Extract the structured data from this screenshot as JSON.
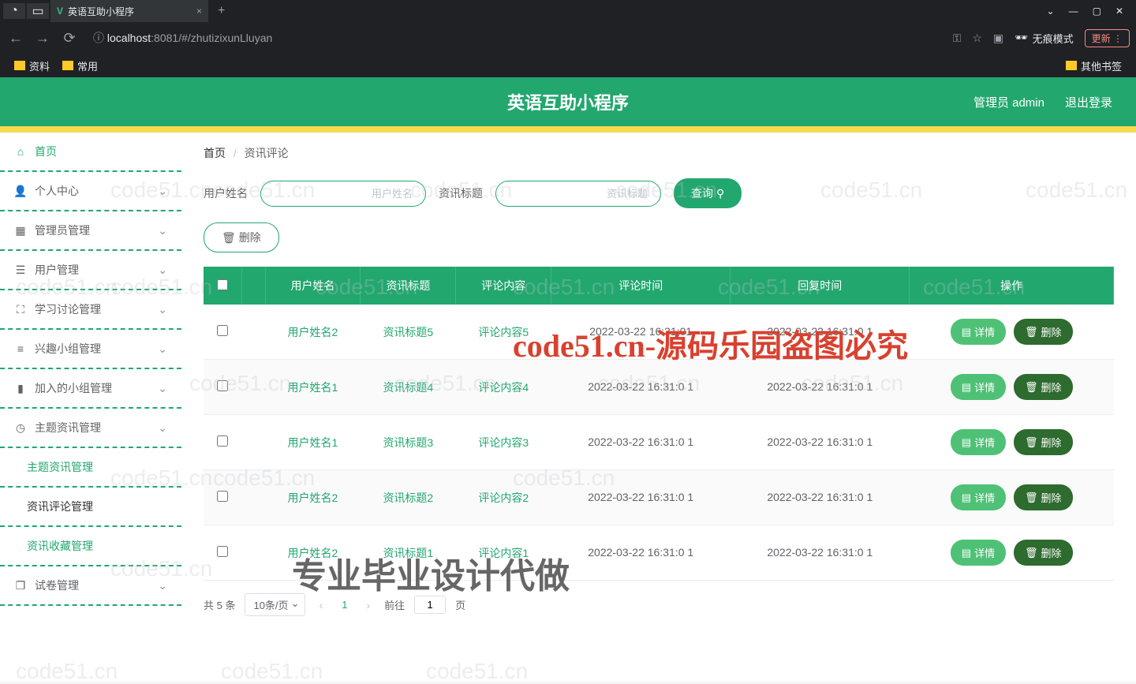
{
  "browser": {
    "tab_title": "英语互助小程序",
    "url_host": "localhost",
    "url_port": ":8081",
    "url_path": "/#/zhutizixunLluyan",
    "bookmarks": [
      "资料",
      "常用"
    ],
    "other_bookmarks": "其他书签",
    "incognito": "无痕模式",
    "update": "更新"
  },
  "header": {
    "title": "英语互助小程序",
    "user_label": "管理员 admin",
    "logout": "退出登录"
  },
  "sidebar": {
    "items": [
      {
        "icon": "home",
        "label": "首页",
        "active": true
      },
      {
        "icon": "user",
        "label": "个人中心",
        "expand": true
      },
      {
        "icon": "admin",
        "label": "管理员管理",
        "expand": true
      },
      {
        "icon": "users",
        "label": "用户管理",
        "expand": true
      },
      {
        "icon": "discuss",
        "label": "学习讨论管理",
        "expand": true
      },
      {
        "icon": "group",
        "label": "兴趣小组管理",
        "expand": true
      },
      {
        "icon": "join",
        "label": "加入的小组管理",
        "expand": true
      },
      {
        "icon": "topic",
        "label": "主题资讯管理",
        "expand": true
      },
      {
        "icon": "paper",
        "label": "试卷管理",
        "expand": true
      }
    ],
    "submenu": [
      "主题资讯管理",
      "资讯评论管理",
      "资讯收藏管理"
    ],
    "submenu_selected_index": 1
  },
  "breadcrumb": {
    "home": "首页",
    "current": "资讯评论"
  },
  "search": {
    "label1": "用户姓名",
    "ph1": "用户姓名",
    "label2": "资讯标题",
    "ph2": "资讯标题",
    "query_btn": "查询",
    "delete_btn": "删除"
  },
  "table": {
    "headers": [
      "",
      "",
      "用户姓名",
      "资讯标题",
      "评论内容",
      "评论时间",
      "回复时间",
      "操作"
    ],
    "rows": [
      {
        "user": "用户姓名2",
        "title": "资讯标题5",
        "content": "评论内容5",
        "ctime": "2022-03-22 16:31:01",
        "rtime": "2022-03-22 16:31:0\n1"
      },
      {
        "user": "用户姓名1",
        "title": "资讯标题4",
        "content": "评论内容4",
        "ctime": "2022-03-22 16:31:0\n1",
        "rtime": "2022-03-22 16:31:0\n1"
      },
      {
        "user": "用户姓名1",
        "title": "资讯标题3",
        "content": "评论内容3",
        "ctime": "2022-03-22 16:31:0\n1",
        "rtime": "2022-03-22 16:31:0\n1"
      },
      {
        "user": "用户姓名2",
        "title": "资讯标题2",
        "content": "评论内容2",
        "ctime": "2022-03-22 16:31:0\n1",
        "rtime": "2022-03-22 16:31:0\n1"
      },
      {
        "user": "用户姓名2",
        "title": "资讯标题1",
        "content": "评论内容1",
        "ctime": "2022-03-22 16:31:0\n1",
        "rtime": "2022-03-22 16:31:0\n1"
      }
    ],
    "detail_btn": "详情",
    "delete_btn": "删除"
  },
  "pagination": {
    "total": "共 5 条",
    "per_page": "10条/页",
    "current": "1",
    "goto": "前往",
    "page_unit": "页",
    "page_input": "1"
  },
  "watermarks": {
    "wm_text": "code51.cn",
    "red": "code51.cn-源码乐园盗图必究",
    "big": "专业毕业设计代做"
  }
}
